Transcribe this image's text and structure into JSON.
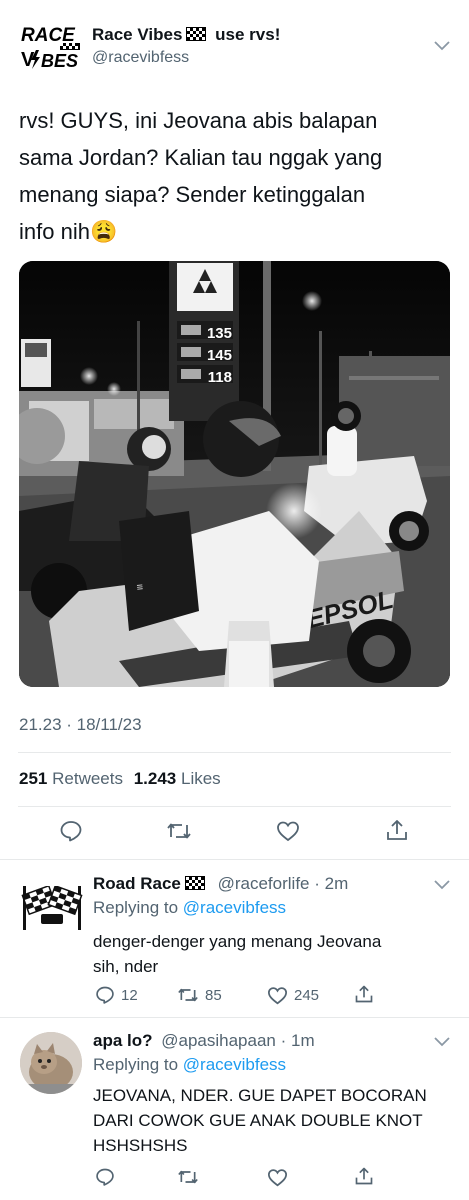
{
  "tweet": {
    "display_name": "Race Vibes",
    "name_suffix": "use rvs!",
    "handle": "@racevibfess",
    "logo_text_top": "RACE",
    "logo_text_bottom": "BES",
    "body_line1": "rvs! GUYS, ini Jeovana abis balapan",
    "body_line2": "sama Jordan? Kalian tau nggak yang",
    "body_line3": "menang siapa? Sender ketinggalan",
    "body_line4": "info nih😩",
    "timestamp": "21.23 · 18/11/23",
    "retweet_count": "251",
    "retweet_label": "Retweets",
    "like_count": "1.243",
    "like_label": "Likes",
    "photo": {
      "price_sign": [
        "135",
        "145",
        "118"
      ],
      "fairing_text": "REPSOL"
    }
  },
  "replies": [
    {
      "display_name": "Road Race",
      "handle": "@raceforlife",
      "time": "2m",
      "replying_label": "Replying to",
      "replying_to": "@racevibfess",
      "text_line1": "denger-denger yang menang Jeovana",
      "text_line2": "sih, nder",
      "reply_count": "12",
      "retweet_count": "85",
      "like_count": "245"
    },
    {
      "display_name": "apa lo?",
      "handle": "@apasihapaan",
      "time": "1m",
      "replying_label": "Replying to",
      "replying_to": "@racevibfess",
      "text_line1": "JEOVANA, NDER. GUE DAPET BOCORAN",
      "text_line2": "DARI COWOK GUE ANAK DOUBLE KNOT",
      "text_line3": "HSHSHSHS"
    }
  ],
  "colors": {
    "accent": "#1d9bf0",
    "muted": "#536471",
    "divider": "#e7e9ea",
    "text": "#0f1419"
  },
  "icons": [
    "reply-icon",
    "retweet-icon",
    "like-icon",
    "share-icon",
    "chevron-down-icon",
    "checkered-flag-icon"
  ]
}
